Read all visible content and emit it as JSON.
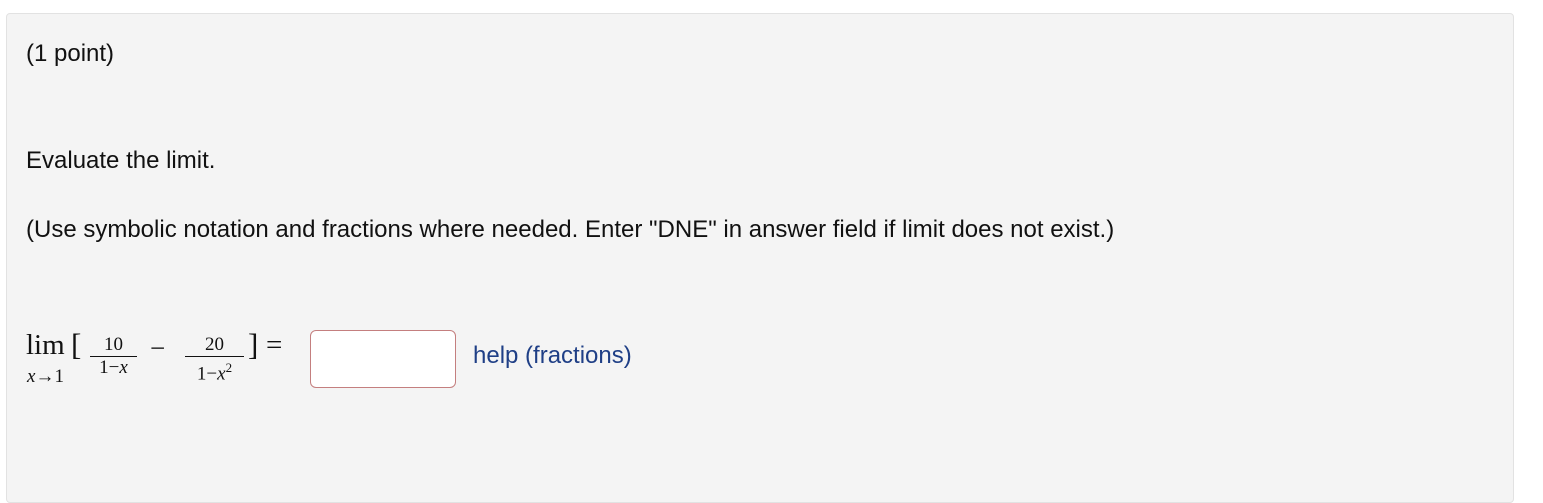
{
  "problem": {
    "points_label": "(1 point)",
    "prompt": "Evaluate the limit.",
    "instructions": "(Use symbolic notation and fractions where needed. Enter \"DNE\" in answer field if limit does not exist.)"
  },
  "expression": {
    "lim": "lim",
    "lim_var": "x",
    "lim_arrow": "→1",
    "bracket_open": "[",
    "frac1_num": "10",
    "frac1_den_lead": "1−",
    "frac1_den_var": "x",
    "minus": "−",
    "frac2_num": "20",
    "frac2_den_lead": "1−",
    "frac2_den_var": "x",
    "frac2_den_exp": "2",
    "bracket_close": "]",
    "equals": "="
  },
  "answer": {
    "value": "",
    "placeholder": ""
  },
  "help": {
    "label": "help (fractions)"
  },
  "colors": {
    "panel_bg": "#f4f4f4",
    "input_border": "#c47f7f",
    "link": "#1f3f86"
  }
}
